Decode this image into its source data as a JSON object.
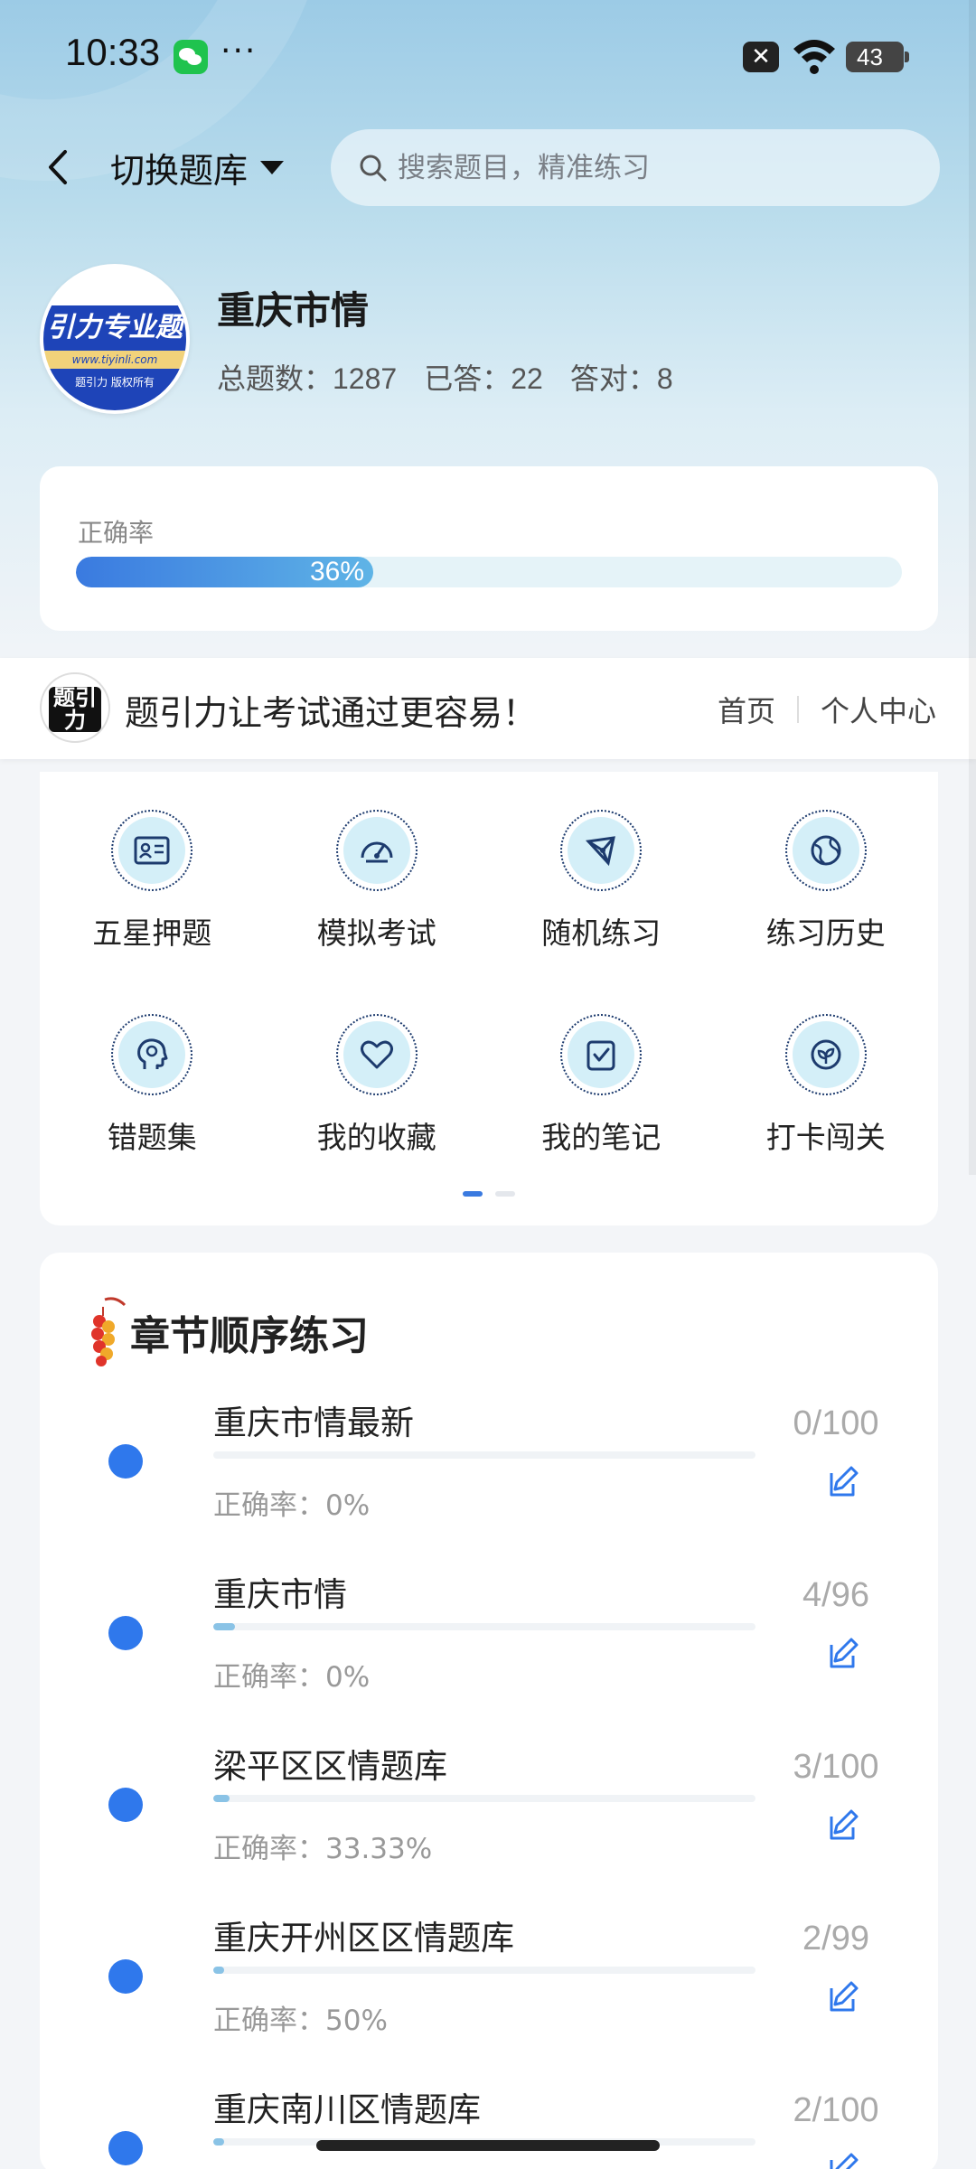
{
  "status_bar": {
    "time": "10:33",
    "dots": "···",
    "battery": "43",
    "close_glyph": "✕"
  },
  "header": {
    "switch_label": "切换题库",
    "search_placeholder": "搜索题目，精准练习"
  },
  "bank": {
    "logo_main": "引力专业题",
    "logo_url": "www.tiyinli.com",
    "logo_bottom": "题引力 版权所有",
    "title": "重庆市情",
    "total": "总题数：1287",
    "answered": "已答：22",
    "correct": "答对：8"
  },
  "accuracy": {
    "label": "正确率",
    "value_text": "36%",
    "value": 0.36
  },
  "banner": {
    "logo_glyph": "题引力",
    "slogan": "题引力让考试通过更容易！",
    "nav_home": "首页",
    "nav_profile": "个人中心"
  },
  "features": [
    {
      "label": "五星押题",
      "icon": "id-card-icon"
    },
    {
      "label": "模拟考试",
      "icon": "gauge-icon"
    },
    {
      "label": "随机练习",
      "icon": "network-icon"
    },
    {
      "label": "练习历史",
      "icon": "globe-icon"
    },
    {
      "label": "错题集",
      "icon": "head-icon"
    },
    {
      "label": "我的收藏",
      "icon": "heart-icon"
    },
    {
      "label": "我的笔记",
      "icon": "note-check-icon"
    },
    {
      "label": "打卡闯关",
      "icon": "leaf-badge-icon"
    }
  ],
  "chapters": {
    "title": "章节顺序练习",
    "items": [
      {
        "name": "重庆市情最新",
        "accuracy": "正确率：0%",
        "count": "0/100",
        "progress": 0.0
      },
      {
        "name": "重庆市情",
        "accuracy": "正确率：0%",
        "count": "4/96",
        "progress": 0.04
      },
      {
        "name": "梁平区区情题库",
        "accuracy": "正确率：33.33%",
        "count": "3/100",
        "progress": 0.03
      },
      {
        "name": "重庆开州区区情题库",
        "accuracy": "正确率：50%",
        "count": "2/99",
        "progress": 0.02
      },
      {
        "name": "重庆南川区情题库",
        "accuracy": "",
        "count": "2/100",
        "progress": 0.02
      }
    ]
  },
  "colors": {
    "accent": "#2f78ec",
    "progress_light": "#8ac3e6"
  }
}
